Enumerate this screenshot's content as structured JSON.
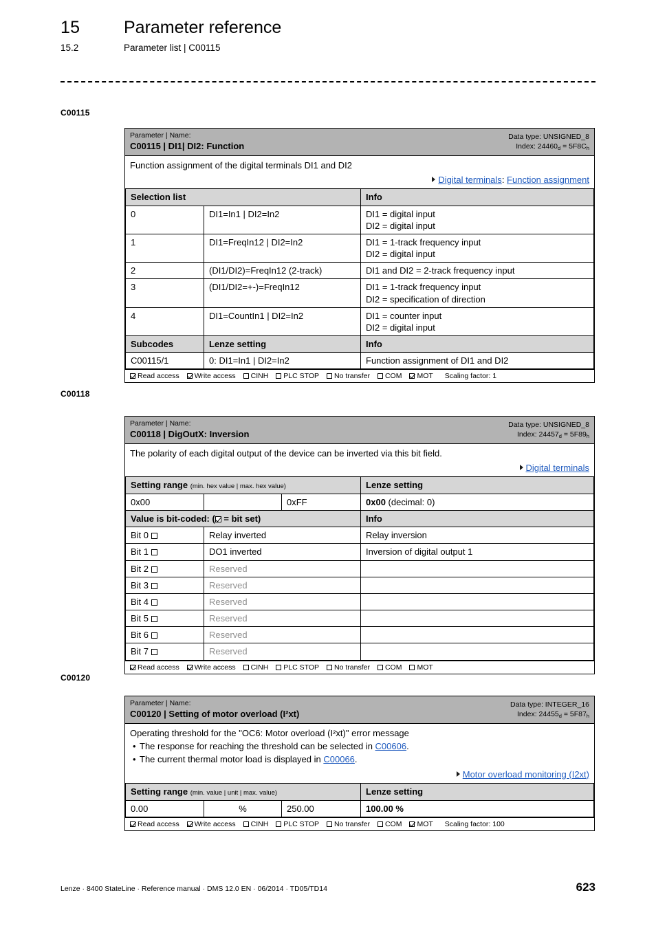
{
  "header": {
    "chapter_number": "15",
    "chapter_title": "Parameter reference",
    "section_number": "15.2",
    "section_title": "Parameter list | C00115"
  },
  "footer": {
    "text": "Lenze · 8400 StateLine · Reference manual · DMS 12.0 EN · 06/2014 · TD05/TD14",
    "page_number": "623"
  },
  "colors": {
    "title_bar_gray": "#b3b3b3",
    "subheader_gray": "#d6d6d6",
    "link_blue": "#1f5bbf",
    "reserved_gray": "#8f8f8f"
  },
  "blocks": [
    {
      "margin_label": "C00115",
      "title_small": "Parameter | Name:",
      "title_main": "C00115 | DI1| DI2: Function",
      "datatype_line": "Data type: UNSIGNED_8",
      "index_prefix": "Index: ",
      "index_dec": "24460",
      "index_dec_sub": "d",
      "index_sep": " = ",
      "index_hex": "5F8C",
      "index_hex_sub": "h",
      "description": "Function assignment of the digital terminals DI1 and DI2",
      "link_row": {
        "link1": "Digital terminals",
        "separator": ": ",
        "link2": "Function assignment"
      },
      "selection_header": {
        "col1": "Selection list",
        "col2": "Info"
      },
      "selection_rows": [
        {
          "num": "0",
          "value": "DI1=In1 | DI2=In2",
          "info": "DI1 = digital input\nDI2 = digital input"
        },
        {
          "num": "1",
          "value": "DI1=FreqIn12 | DI2=In2",
          "info": "DI1 = 1-track frequency input\nDI2 = digital input"
        },
        {
          "num": "2",
          "value": "(DI1/DI2)=FreqIn12 (2-track)",
          "info": "DI1 and DI2 = 2-track frequency input"
        },
        {
          "num": "3",
          "value": "(DI1/DI2=+-)=FreqIn12",
          "info": "DI1 = 1-track frequency input\nDI2 = specification of direction"
        },
        {
          "num": "4",
          "value": "DI1=CountIn1 | DI2=In2",
          "info": "DI1 = counter input\nDI2 = digital input"
        }
      ],
      "subcodes_header": {
        "col1": "Subcodes",
        "col2": "Lenze setting",
        "col3": "Info"
      },
      "subcodes_rows": [
        {
          "subcode": "C00115/1",
          "lenze_setting": "0: DI1=In1 | DI2=In2",
          "info": "Function assignment of DI1 and DI2"
        }
      ],
      "access": {
        "items": [
          {
            "label": "Read access",
            "checked": true
          },
          {
            "label": "Write access",
            "checked": true
          },
          {
            "label": "CINH",
            "checked": false
          },
          {
            "label": "PLC STOP",
            "checked": false
          },
          {
            "label": "No transfer",
            "checked": false
          },
          {
            "label": "COM",
            "checked": false
          },
          {
            "label": "MOT",
            "checked": true
          }
        ],
        "scaling": "Scaling factor: 1"
      }
    },
    {
      "margin_label": "C00118",
      "title_small": "Parameter | Name:",
      "title_main": "C00118 | DigOutX: Inversion",
      "datatype_line": "Data type: UNSIGNED_8",
      "index_prefix": "Index: ",
      "index_dec": "24457",
      "index_dec_sub": "d",
      "index_sep": " = ",
      "index_hex": "5F89",
      "index_hex_sub": "h",
      "description": "The polarity of each digital output of the device can be inverted via this bit field.",
      "link_row": {
        "link1": "Digital terminals",
        "separator": "",
        "link2": ""
      },
      "range_header": {
        "title": "Setting range",
        "note": "(min. hex value | max. hex value)",
        "lenze": "Lenze setting"
      },
      "range_row": {
        "min": "0x00",
        "mid": "",
        "max": "0xFF",
        "lenze_bold": "0x00",
        "lenze_rest": "(decimal: 0)"
      },
      "bit_header": {
        "title_prefix": "Value is bit-coded:  (",
        "title_suffix": " = bit set)",
        "info": "Info"
      },
      "bit_rows": [
        {
          "bit": "Bit 0",
          "checked": false,
          "label": "Relay inverted",
          "reserved": false,
          "info": "Relay inversion"
        },
        {
          "bit": "Bit 1",
          "checked": false,
          "label": "DO1 inverted",
          "reserved": false,
          "info": "Inversion of digital output 1"
        },
        {
          "bit": "Bit 2",
          "checked": false,
          "label": "Reserved",
          "reserved": true,
          "info": ""
        },
        {
          "bit": "Bit 3",
          "checked": false,
          "label": "Reserved",
          "reserved": true,
          "info": ""
        },
        {
          "bit": "Bit 4",
          "checked": false,
          "label": "Reserved",
          "reserved": true,
          "info": ""
        },
        {
          "bit": "Bit 5",
          "checked": false,
          "label": "Reserved",
          "reserved": true,
          "info": ""
        },
        {
          "bit": "Bit 6",
          "checked": false,
          "label": "Reserved",
          "reserved": true,
          "info": ""
        },
        {
          "bit": "Bit 7",
          "checked": false,
          "label": "Reserved",
          "reserved": true,
          "info": ""
        }
      ],
      "access": {
        "items": [
          {
            "label": "Read access",
            "checked": true
          },
          {
            "label": "Write access",
            "checked": true
          },
          {
            "label": "CINH",
            "checked": false
          },
          {
            "label": "PLC STOP",
            "checked": false
          },
          {
            "label": "No transfer",
            "checked": false
          },
          {
            "label": "COM",
            "checked": false
          },
          {
            "label": "MOT",
            "checked": false
          }
        ],
        "scaling": ""
      }
    },
    {
      "margin_label": "C00120",
      "title_small": "Parameter | Name:",
      "title_main": "C00120 | Setting of motor overload (I²xt)",
      "datatype_line": "Data type: INTEGER_16",
      "index_prefix": "Index: ",
      "index_dec": "24455",
      "index_dec_sub": "d",
      "index_sep": " = ",
      "index_hex": "5F87",
      "index_hex_sub": "h",
      "description": "Operating threshold for the \"OC6: Motor overload (I²xt)\" error message",
      "bullets": [
        {
          "pre": "The response for reaching the threshold can be selected in ",
          "link": "C00606",
          "post": "."
        },
        {
          "pre": "The current thermal motor load is displayed in ",
          "link": "C00066",
          "post": "."
        }
      ],
      "link_row": {
        "link1": "Motor overload monitoring (I2xt)",
        "separator": "",
        "link2": ""
      },
      "range_header": {
        "title": "Setting range",
        "note": "(min. value | unit | max. value)",
        "lenze": "Lenze setting"
      },
      "range_row": {
        "min": "0.00",
        "mid": "%",
        "max": "250.00",
        "lenze_bold": "100.00 %",
        "lenze_rest": ""
      },
      "access": {
        "items": [
          {
            "label": "Read access",
            "checked": true
          },
          {
            "label": "Write access",
            "checked": true
          },
          {
            "label": "CINH",
            "checked": false
          },
          {
            "label": "PLC STOP",
            "checked": false
          },
          {
            "label": "No transfer",
            "checked": false
          },
          {
            "label": "COM",
            "checked": false
          },
          {
            "label": "MOT",
            "checked": true
          }
        ],
        "scaling": "Scaling factor: 100"
      }
    }
  ]
}
